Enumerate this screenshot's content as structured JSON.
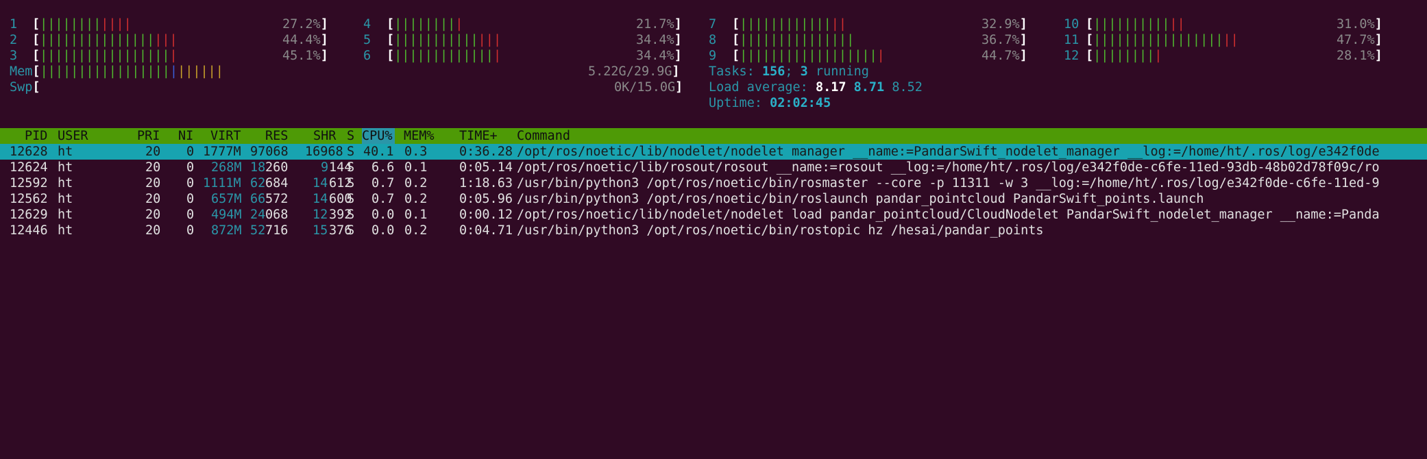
{
  "cpus": [
    {
      "id": "1",
      "green": "||||||||",
      "red": "||||",
      "pct": "27.2%"
    },
    {
      "id": "2",
      "green": "|||||||||||||||",
      "red": "|||",
      "pct": "44.4%"
    },
    {
      "id": "3",
      "green": "|||||||||||||||||",
      "red": "|",
      "pct": "45.1%"
    },
    {
      "id": "4",
      "green": "||||||||",
      "red": "|",
      "pct": "21.7%"
    },
    {
      "id": "5",
      "green": "|||||||||||",
      "red": "|||",
      "pct": "34.4%"
    },
    {
      "id": "6",
      "green": "|||||||||||||",
      "red": "|",
      "pct": "34.4%"
    },
    {
      "id": "7",
      "green": "||||||||||||",
      "red": "||",
      "pct": "32.9%"
    },
    {
      "id": "8",
      "green": "|||||||||||||||",
      "red": "",
      "pct": "36.7%"
    },
    {
      "id": "9",
      "green": "||||||||||||||||||",
      "red": "|",
      "pct": "44.7%"
    },
    {
      "id": "10",
      "green": "||||||||||",
      "red": "||",
      "pct": "31.0%"
    },
    {
      "id": "11",
      "green": "|||||||||||||||||",
      "red": "||",
      "pct": "47.7%"
    },
    {
      "id": "12",
      "green": "||||||||",
      "red": "|",
      "pct": "28.1%"
    }
  ],
  "mem": {
    "label": "Mem",
    "green": "|||||||||||||||||",
    "blue": "|",
    "yellow": "||||||",
    "value": "5.22G/29.9G"
  },
  "swp": {
    "label": "Swp",
    "value": "0K/15.0G"
  },
  "tasks": {
    "label": "Tasks:",
    "count": "156",
    "sep": ";",
    "running": "3",
    "running_label": "running"
  },
  "load": {
    "label": "Load average:",
    "v1": "8.17",
    "v5": "8.71",
    "v15": "8.52"
  },
  "uptime": {
    "label": "Uptime:",
    "value": "02:02:45"
  },
  "header": {
    "pid": "PID",
    "user": "USER",
    "pri": "PRI",
    "ni": "NI",
    "virt": "VIRT",
    "res": "RES",
    "shr": "SHR",
    "s": "S",
    "cpu": "CPU%",
    "mem": "MEM%",
    "time": "TIME+",
    "command": "Command"
  },
  "processes": [
    {
      "pid": "12628",
      "user": "ht",
      "pri": "20",
      "ni": "0",
      "virt_a": "1777M",
      "virt_b": "",
      "res_a": "97068",
      "res_b": "",
      "shr_a": "16968",
      "shr_b": "",
      "s": "S",
      "cpu": "40.1",
      "mem": "0.3",
      "time": "0:36.28",
      "command": "/opt/ros/noetic/lib/nodelet/nodelet manager __name:=PandarSwift_nodelet_manager __log:=/home/ht/.ros/log/e342f0de"
    },
    {
      "pid": "12624",
      "user": "ht",
      "pri": "20",
      "ni": "0",
      "virt_a": "268M",
      "res_a": "18",
      "res_b": "260",
      "shr_a": "9",
      "shr_b": "144",
      "s": "S",
      "cpu": "6.6",
      "mem": "0.1",
      "time": "0:05.14",
      "command": "/opt/ros/noetic/lib/rosout/rosout __name:=rosout __log:=/home/ht/.ros/log/e342f0de-c6fe-11ed-93db-48b02d78f09c/ro"
    },
    {
      "pid": "12592",
      "user": "ht",
      "pri": "20",
      "ni": "0",
      "virt_a": "1111M",
      "res_a": "62",
      "res_b": "684",
      "shr_a": "14",
      "shr_b": "612",
      "s": "S",
      "cpu": "0.7",
      "mem": "0.2",
      "time": "1:18.63",
      "command": "/usr/bin/python3 /opt/ros/noetic/bin/rosmaster --core -p 11311 -w 3 __log:=/home/ht/.ros/log/e342f0de-c6fe-11ed-9"
    },
    {
      "pid": "12562",
      "user": "ht",
      "pri": "20",
      "ni": "0",
      "virt_a": "657M",
      "res_a": "66",
      "res_b": "572",
      "shr_a": "14",
      "shr_b": "600",
      "s": "S",
      "cpu": "0.7",
      "mem": "0.2",
      "time": "0:05.96",
      "command": "/usr/bin/python3 /opt/ros/noetic/bin/roslaunch pandar_pointcloud PandarSwift_points.launch"
    },
    {
      "pid": "12629",
      "user": "ht",
      "pri": "20",
      "ni": "0",
      "virt_a": "494M",
      "res_a": "24",
      "res_b": "068",
      "shr_a": "12",
      "shr_b": "392",
      "s": "S",
      "cpu": "0.0",
      "mem": "0.1",
      "time": "0:00.12",
      "command": "/opt/ros/noetic/lib/nodelet/nodelet load pandar_pointcloud/CloudNodelet PandarSwift_nodelet_manager __name:=Panda"
    },
    {
      "pid": "12446",
      "user": "ht",
      "pri": "20",
      "ni": "0",
      "virt_a": "872M",
      "res_a": "52",
      "res_b": "716",
      "shr_a": "15",
      "shr_b": "376",
      "s": "S",
      "cpu": "0.0",
      "mem": "0.2",
      "time": "0:04.71",
      "command": "/usr/bin/python3 /opt/ros/noetic/bin/rostopic hz /hesai/pandar_points"
    }
  ]
}
